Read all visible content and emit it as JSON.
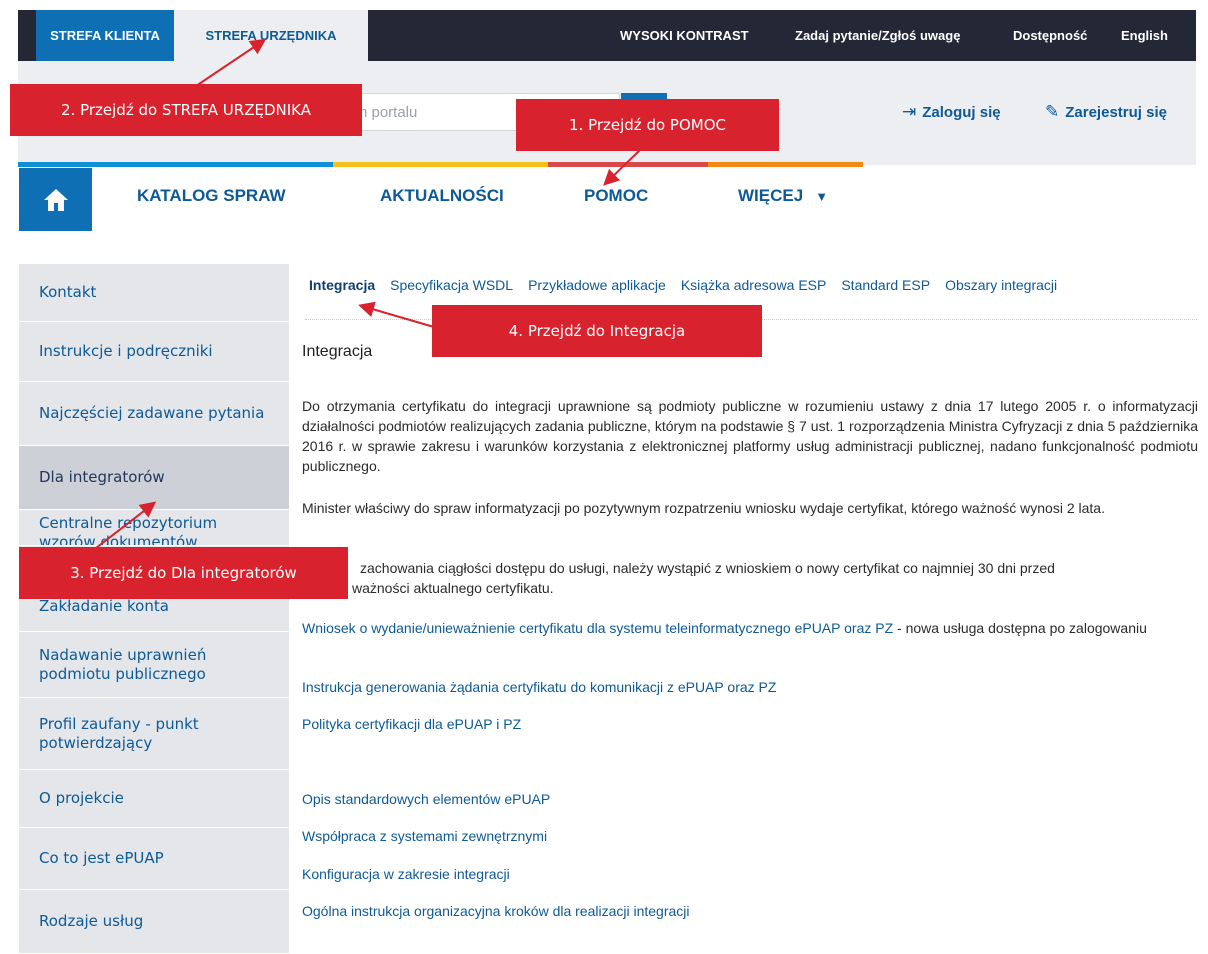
{
  "topbar": {
    "tab_klient": "STREFA KLIENTA",
    "tab_urzednika": "STREFA URZĘDNIKA",
    "high_contrast": "WYSOKI KONTRAST",
    "ask": "Zadaj pytanie/Zgłoś uwagę",
    "accessibility": "Dostępność",
    "english": "English"
  },
  "search": {
    "placeholder": "łym portalu"
  },
  "auth": {
    "login": "Zaloguj się",
    "register": "Zarejestruj się"
  },
  "colors": {
    "blue": "#0e8fd6",
    "yellow": "#f1c21b",
    "red": "#d84a4a",
    "orange": "#f08a14",
    "brand": "#0e6fb4",
    "annotation": "#d8222d"
  },
  "nav": {
    "home_icon": "home-icon",
    "items": [
      "KATALOG SPRAW",
      "AKTUALNOŚCI",
      "POMOC",
      "WIĘCEJ"
    ],
    "more_caret": "▼"
  },
  "sidebar": {
    "items": [
      "Kontakt",
      "Instrukcje i podręczniki",
      "Najczęściej zadawane pytania",
      "Dla integratorów",
      "Centralne repozytorium wzorów dokumentów",
      "Zakładanie konta",
      "Nadawanie uprawnień podmiotu publicznego",
      "Profil zaufany - punkt potwierdzający",
      "O projekcie",
      "Co to jest ePUAP",
      "Rodzaje usług"
    ]
  },
  "subnav": [
    "Integracja",
    "Specyfikacja WSDL",
    "Przykładowe aplikacje",
    "Książka adresowa ESP",
    "Standard ESP",
    "Obszary integracji"
  ],
  "content": {
    "heading": "Integracja",
    "para1": "Do otrzymania certyfikatu do integracji uprawnione są podmioty publiczne w rozumieniu ustawy z dnia 17 lutego 2005 r. o informatyzacji działalności podmiotów realizujących zadania publiczne, którym na podstawie § 7 ust. 1 rozporządzenia Ministra Cyfryzacji z dnia 5 października 2016 r. w sprawie zakresu i warunków korzystania z elektronicznej platformy usług administracji publicznej, nadano funkcjonalność podmiotu publicznego.",
    "para2": "Minister właściwy do spraw informatyzacji po pozytywnym rozpatrzeniu wniosku wydaje certyfikat, którego ważność wynosi 2 lata.",
    "para3_line1": "zachowania ciągłości dostępu do usługi, należy wystąpić z wnioskiem o nowy certyfikat co najmniej 30 dni przed",
    "para3_line2": "ważności aktualnego certyfikatu.",
    "link1": "Wniosek o wydanie/unieważnienie certyfikatu dla systemu teleinformatycznego ePUAP oraz PZ",
    "link1_suffix": " - nowa usługa dostępna po zalogowaniu",
    "link2": "Instrukcja generowania żądania certyfikatu do komunikacji z ePUAP oraz PZ",
    "link3": "Polityka certyfikacji dla ePUAP i PZ",
    "link4": "Opis standardowych elementów ePUAP",
    "link5": "Współpraca z systemami zewnętrznymi",
    "link6": "Konfiguracja w zakresie integracji",
    "link7": "Ogólna instrukcja organizacyjna kroków dla realizacji integracji"
  },
  "annotations": {
    "step1": "1. Przejdź do POMOC",
    "step2": "2. Przejdź do STREFA URZĘDNIKA",
    "step3": "3. Przejdź do Dla integratorów",
    "step4": "4. Przejdź do Integracja"
  }
}
